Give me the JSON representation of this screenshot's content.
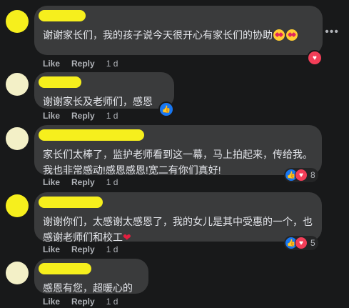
{
  "more_icon": "more-horizontal-icon",
  "comments": [
    {
      "text": "谢谢家长们，我的孩子说今天很开心有家长们的协助",
      "emoji": "star-struck-emoji",
      "like_label": "Like",
      "reply_label": "Reply",
      "time": "1 d",
      "reaction": "love"
    },
    {
      "text": "谢谢家长及老师们，感恩",
      "like_label": "Like",
      "reply_label": "Reply",
      "time": "1 d",
      "reaction": "like"
    },
    {
      "text": "家长们太棒了，监护老师看到这一幕，马上拍起来，传给我。我也非常感动!感恩感恩!宽二有你们真好!",
      "like_label": "Like",
      "reply_label": "Reply",
      "time": "1 d",
      "reactions": [
        "like",
        "love"
      ],
      "reaction_count": "8"
    },
    {
      "text": "谢谢你们，太感谢太感恩了，我的女儿是其中受惠的一个，也感谢老师们和校工",
      "heart": "❤",
      "like_label": "Like",
      "reply_label": "Reply",
      "time": "1 d",
      "reactions": [
        "like",
        "love"
      ],
      "reaction_count": "5"
    },
    {
      "text": "感恩有您，超暖心的",
      "like_label": "Like",
      "reply_label": "Reply",
      "time": "1 d"
    }
  ],
  "colors": {
    "background": "#18191a",
    "bubble": "#3a3b3c",
    "redaction": "#f6ef1d",
    "like": "#1877f2",
    "love": "#f33e58"
  }
}
